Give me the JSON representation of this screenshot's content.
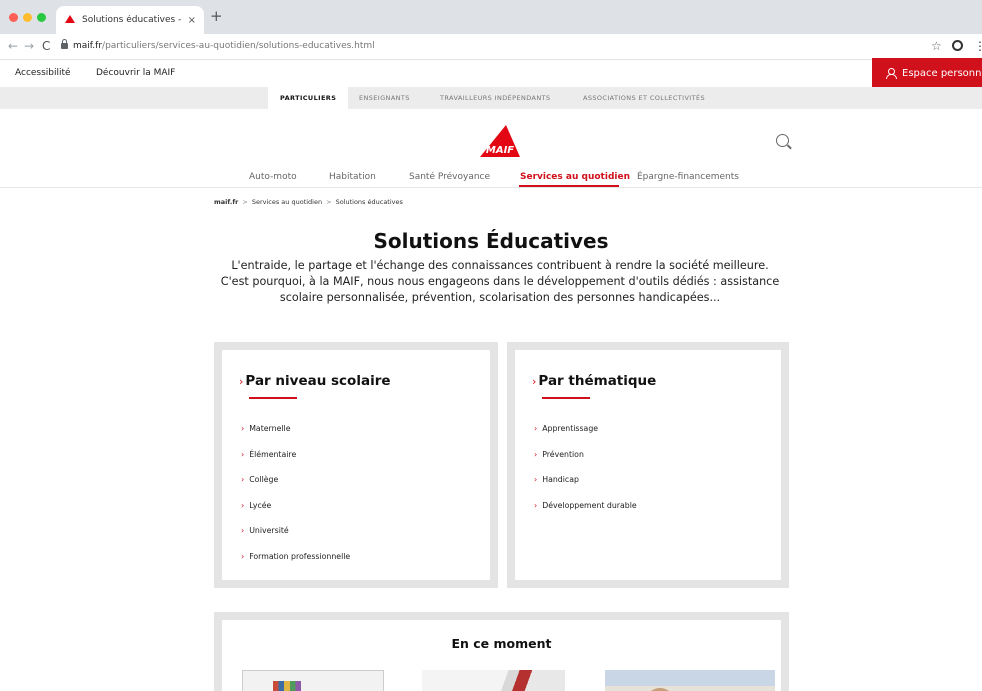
{
  "browser": {
    "tab_title": "Solutions éducatives - MAIF",
    "tab_close": "×",
    "new_tab": "+",
    "url_domain": "maif.fr",
    "url_path": "/particuliers/services-au-quotidien/solutions-educatives.html",
    "back": "←",
    "forward": "→",
    "reload": "C",
    "star": "☆",
    "kebab": "⋮"
  },
  "utility": {
    "accessibility": "Accessibilité",
    "discover": "Découvrir la MAIF",
    "espace": "Espace personnel"
  },
  "segments": [
    {
      "label": "PARTICULIERS",
      "active": true
    },
    {
      "label": "ENSEIGNANTS",
      "active": false
    },
    {
      "label": "TRAVAILLEURS INDÉPENDANTS",
      "active": false
    },
    {
      "label": "ASSOCIATIONS ET COLLECTIVITÉS",
      "active": false
    }
  ],
  "logo_text": "MAIF",
  "nav": [
    {
      "label": "Auto-moto",
      "active": false
    },
    {
      "label": "Habitation",
      "active": false
    },
    {
      "label": "Santé Prévoyance",
      "active": false
    },
    {
      "label": "Services au quotidien",
      "active": true
    },
    {
      "label": "Épargne-financements",
      "active": false
    }
  ],
  "breadcrumb": {
    "home": "maif.fr",
    "sep": ">",
    "level1": "Services au quotidien",
    "current": "Solutions éducatives"
  },
  "page": {
    "title": "Solutions Éducatives",
    "intro": "L'entraide, le partage et l'échange des connaissances contribuent à rendre la société meilleure. C'est pourquoi, à la MAIF, nous nous engageons dans le développement d'outils dédiés : assistance scolaire personnalisée, prévention, scolarisation des personnes handicapées..."
  },
  "cards": {
    "niveau": {
      "title": "Par niveau scolaire",
      "items": [
        "Maternelle",
        "Élémentaire",
        "Collège",
        "Lycée",
        "Université",
        "Formation professionnelle"
      ]
    },
    "thematique": {
      "title": "Par thématique",
      "items": [
        "Apprentissage",
        "Prévention",
        "Handicap",
        "Développement durable"
      ]
    }
  },
  "moment": {
    "title": "En ce moment"
  },
  "colors": {
    "brand_red": "#d0101a",
    "card_frame": "#e4e4e4",
    "segment_bar": "#ececec"
  },
  "icons": {
    "chevron": "›"
  }
}
